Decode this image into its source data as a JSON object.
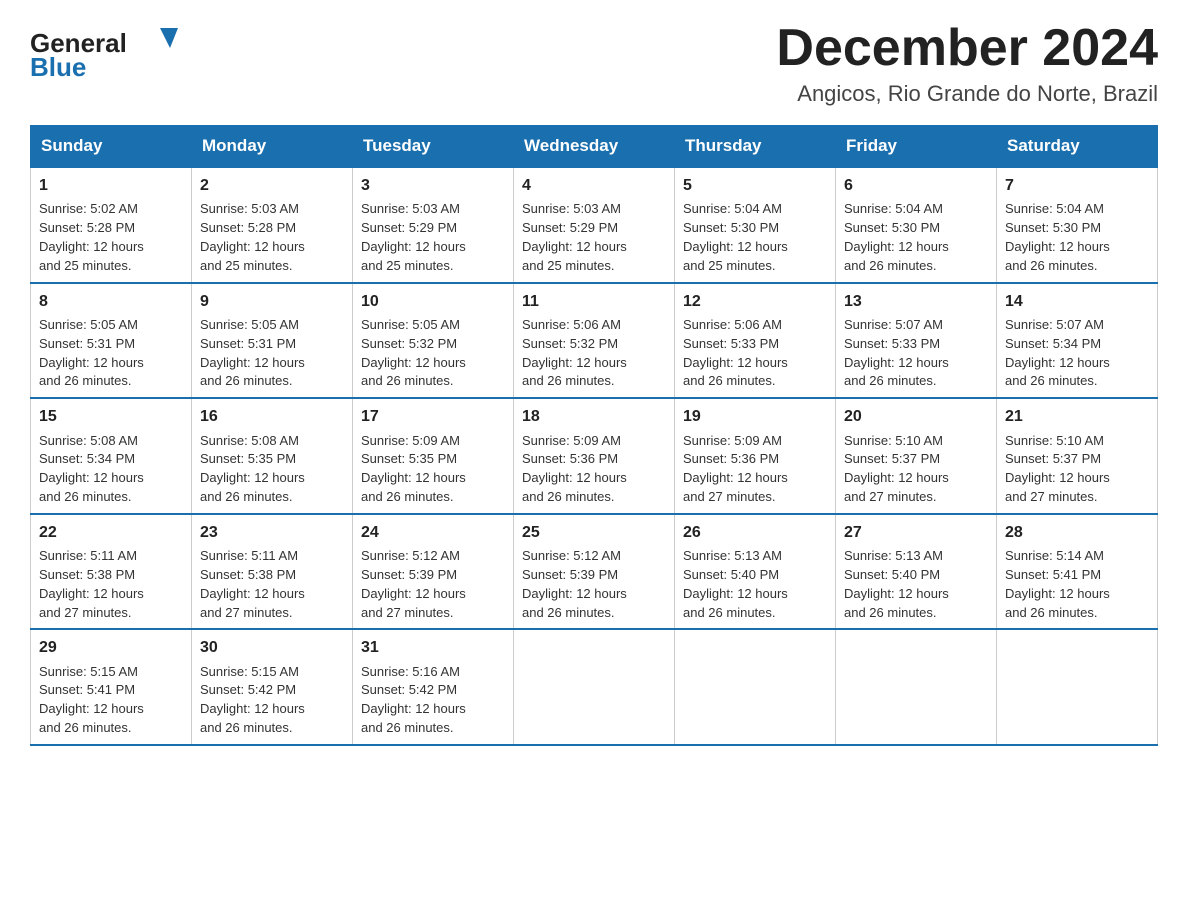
{
  "header": {
    "logo_general": "General",
    "logo_blue": "Blue",
    "month_title": "December 2024",
    "location": "Angicos, Rio Grande do Norte, Brazil"
  },
  "days_of_week": [
    "Sunday",
    "Monday",
    "Tuesday",
    "Wednesday",
    "Thursday",
    "Friday",
    "Saturday"
  ],
  "weeks": [
    [
      {
        "day": "1",
        "sunrise": "5:02 AM",
        "sunset": "5:28 PM",
        "daylight": "12 hours and 25 minutes."
      },
      {
        "day": "2",
        "sunrise": "5:03 AM",
        "sunset": "5:28 PM",
        "daylight": "12 hours and 25 minutes."
      },
      {
        "day": "3",
        "sunrise": "5:03 AM",
        "sunset": "5:29 PM",
        "daylight": "12 hours and 25 minutes."
      },
      {
        "day": "4",
        "sunrise": "5:03 AM",
        "sunset": "5:29 PM",
        "daylight": "12 hours and 25 minutes."
      },
      {
        "day": "5",
        "sunrise": "5:04 AM",
        "sunset": "5:30 PM",
        "daylight": "12 hours and 25 minutes."
      },
      {
        "day": "6",
        "sunrise": "5:04 AM",
        "sunset": "5:30 PM",
        "daylight": "12 hours and 26 minutes."
      },
      {
        "day": "7",
        "sunrise": "5:04 AM",
        "sunset": "5:30 PM",
        "daylight": "12 hours and 26 minutes."
      }
    ],
    [
      {
        "day": "8",
        "sunrise": "5:05 AM",
        "sunset": "5:31 PM",
        "daylight": "12 hours and 26 minutes."
      },
      {
        "day": "9",
        "sunrise": "5:05 AM",
        "sunset": "5:31 PM",
        "daylight": "12 hours and 26 minutes."
      },
      {
        "day": "10",
        "sunrise": "5:05 AM",
        "sunset": "5:32 PM",
        "daylight": "12 hours and 26 minutes."
      },
      {
        "day": "11",
        "sunrise": "5:06 AM",
        "sunset": "5:32 PM",
        "daylight": "12 hours and 26 minutes."
      },
      {
        "day": "12",
        "sunrise": "5:06 AM",
        "sunset": "5:33 PM",
        "daylight": "12 hours and 26 minutes."
      },
      {
        "day": "13",
        "sunrise": "5:07 AM",
        "sunset": "5:33 PM",
        "daylight": "12 hours and 26 minutes."
      },
      {
        "day": "14",
        "sunrise": "5:07 AM",
        "sunset": "5:34 PM",
        "daylight": "12 hours and 26 minutes."
      }
    ],
    [
      {
        "day": "15",
        "sunrise": "5:08 AM",
        "sunset": "5:34 PM",
        "daylight": "12 hours and 26 minutes."
      },
      {
        "day": "16",
        "sunrise": "5:08 AM",
        "sunset": "5:35 PM",
        "daylight": "12 hours and 26 minutes."
      },
      {
        "day": "17",
        "sunrise": "5:09 AM",
        "sunset": "5:35 PM",
        "daylight": "12 hours and 26 minutes."
      },
      {
        "day": "18",
        "sunrise": "5:09 AM",
        "sunset": "5:36 PM",
        "daylight": "12 hours and 26 minutes."
      },
      {
        "day": "19",
        "sunrise": "5:09 AM",
        "sunset": "5:36 PM",
        "daylight": "12 hours and 27 minutes."
      },
      {
        "day": "20",
        "sunrise": "5:10 AM",
        "sunset": "5:37 PM",
        "daylight": "12 hours and 27 minutes."
      },
      {
        "day": "21",
        "sunrise": "5:10 AM",
        "sunset": "5:37 PM",
        "daylight": "12 hours and 27 minutes."
      }
    ],
    [
      {
        "day": "22",
        "sunrise": "5:11 AM",
        "sunset": "5:38 PM",
        "daylight": "12 hours and 27 minutes."
      },
      {
        "day": "23",
        "sunrise": "5:11 AM",
        "sunset": "5:38 PM",
        "daylight": "12 hours and 27 minutes."
      },
      {
        "day": "24",
        "sunrise": "5:12 AM",
        "sunset": "5:39 PM",
        "daylight": "12 hours and 27 minutes."
      },
      {
        "day": "25",
        "sunrise": "5:12 AM",
        "sunset": "5:39 PM",
        "daylight": "12 hours and 26 minutes."
      },
      {
        "day": "26",
        "sunrise": "5:13 AM",
        "sunset": "5:40 PM",
        "daylight": "12 hours and 26 minutes."
      },
      {
        "day": "27",
        "sunrise": "5:13 AM",
        "sunset": "5:40 PM",
        "daylight": "12 hours and 26 minutes."
      },
      {
        "day": "28",
        "sunrise": "5:14 AM",
        "sunset": "5:41 PM",
        "daylight": "12 hours and 26 minutes."
      }
    ],
    [
      {
        "day": "29",
        "sunrise": "5:15 AM",
        "sunset": "5:41 PM",
        "daylight": "12 hours and 26 minutes."
      },
      {
        "day": "30",
        "sunrise": "5:15 AM",
        "sunset": "5:42 PM",
        "daylight": "12 hours and 26 minutes."
      },
      {
        "day": "31",
        "sunrise": "5:16 AM",
        "sunset": "5:42 PM",
        "daylight": "12 hours and 26 minutes."
      },
      null,
      null,
      null,
      null
    ]
  ],
  "labels": {
    "sunrise": "Sunrise:",
    "sunset": "Sunset:",
    "daylight": "Daylight:"
  }
}
